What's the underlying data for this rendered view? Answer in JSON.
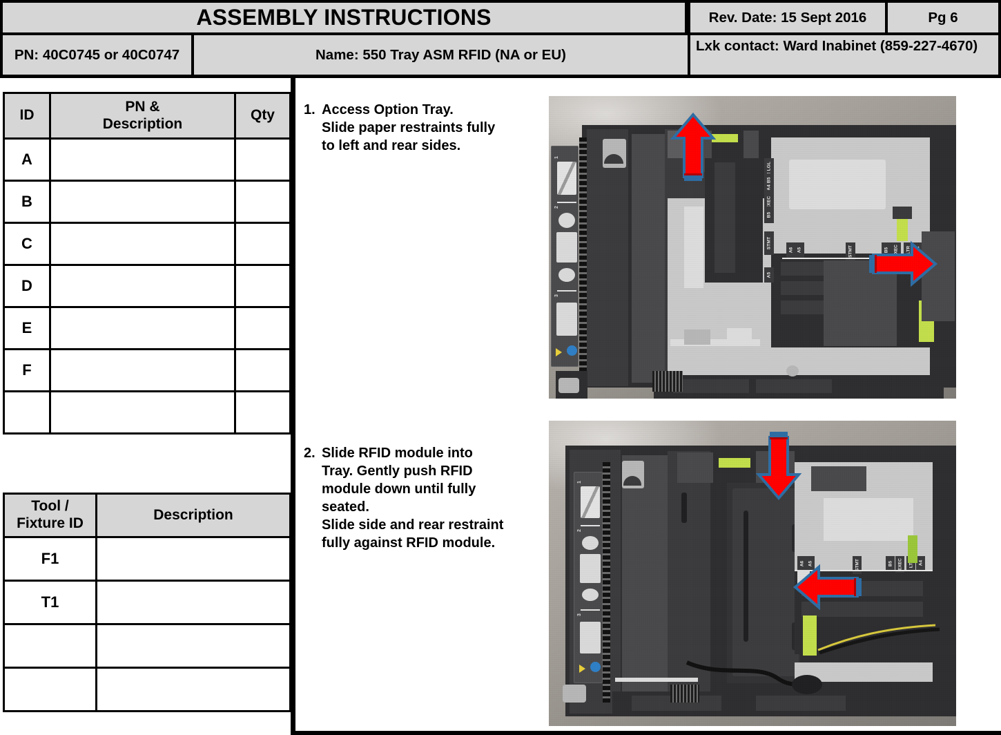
{
  "header": {
    "title": "ASSEMBLY INSTRUCTIONS",
    "rev_date": "Rev. Date: 15 Sept 2016",
    "page": "Pg  6",
    "pn": "PN:  40C0745 or 40C0747",
    "name": "Name:  550 Tray ASM RFID (NA or EU)",
    "contact": "Lxk contact: Ward Inabinet (859-227-4670)"
  },
  "parts_table": {
    "columns": {
      "id": "ID",
      "pn_desc": "PN &\nDescription",
      "qty": "Qty"
    },
    "col_id": "ID",
    "col_pn_line1": "PN &",
    "col_pn_line2": "Description",
    "col_qty": "Qty",
    "rows": [
      {
        "id": "A",
        "pn_desc": "",
        "qty": ""
      },
      {
        "id": "B",
        "pn_desc": "",
        "qty": ""
      },
      {
        "id": "C",
        "pn_desc": "",
        "qty": ""
      },
      {
        "id": "D",
        "pn_desc": "",
        "qty": ""
      },
      {
        "id": "E",
        "pn_desc": "",
        "qty": ""
      },
      {
        "id": "F",
        "pn_desc": "",
        "qty": ""
      },
      {
        "id": "",
        "pn_desc": "",
        "qty": ""
      }
    ]
  },
  "tool_table": {
    "col_id_line1": "Tool /",
    "col_id_line2": "Fixture ID",
    "col_desc": "Description",
    "rows": [
      {
        "id": "F1",
        "desc": ""
      },
      {
        "id": "T1",
        "desc": ""
      },
      {
        "id": "",
        "desc": ""
      },
      {
        "id": "",
        "desc": ""
      }
    ]
  },
  "steps": [
    {
      "number": "1.",
      "lines": [
        "Access Option Tray.",
        "Slide paper restraints fully",
        "to left and rear sides."
      ]
    },
    {
      "number": "2.",
      "lines": [
        "Slide RFID module into",
        "Tray. Gently push RFID",
        "module down until fully",
        "seated.",
        "Slide side and rear restraint",
        "fully against RFID module."
      ]
    }
  ],
  "photos": [
    {
      "caption_ref": "step-1",
      "description": "Top view of open 550-sheet option tray with paper restraints",
      "arrows": [
        {
          "direction": "up",
          "meaning": "slide rear restraint to rear"
        },
        {
          "direction": "right",
          "meaning": "slide side restraint to left/outward"
        }
      ],
      "paper_size_labels": [
        "LTR",
        "LGL",
        "A4",
        "B5",
        "EXEC",
        "STMT",
        "A5",
        "A6",
        "LTR",
        "A4"
      ]
    },
    {
      "caption_ref": "step-2",
      "description": "Top view of tray with RFID module seated inside",
      "arrows": [
        {
          "direction": "down",
          "meaning": "push RFID module down until seated"
        },
        {
          "direction": "left",
          "meaning": "slide restraint against RFID module"
        }
      ],
      "paper_size_labels": [
        "A5",
        "A6",
        "STMT",
        "B5",
        "EXEC",
        "LTR",
        "A4"
      ]
    }
  ],
  "colors": {
    "arrow_fill": "#FF0000",
    "arrow_outline": "#2E6DA4",
    "header_fill": "#D6D6D6",
    "rule": "#000000",
    "tab_green": "#C3DE4B"
  }
}
